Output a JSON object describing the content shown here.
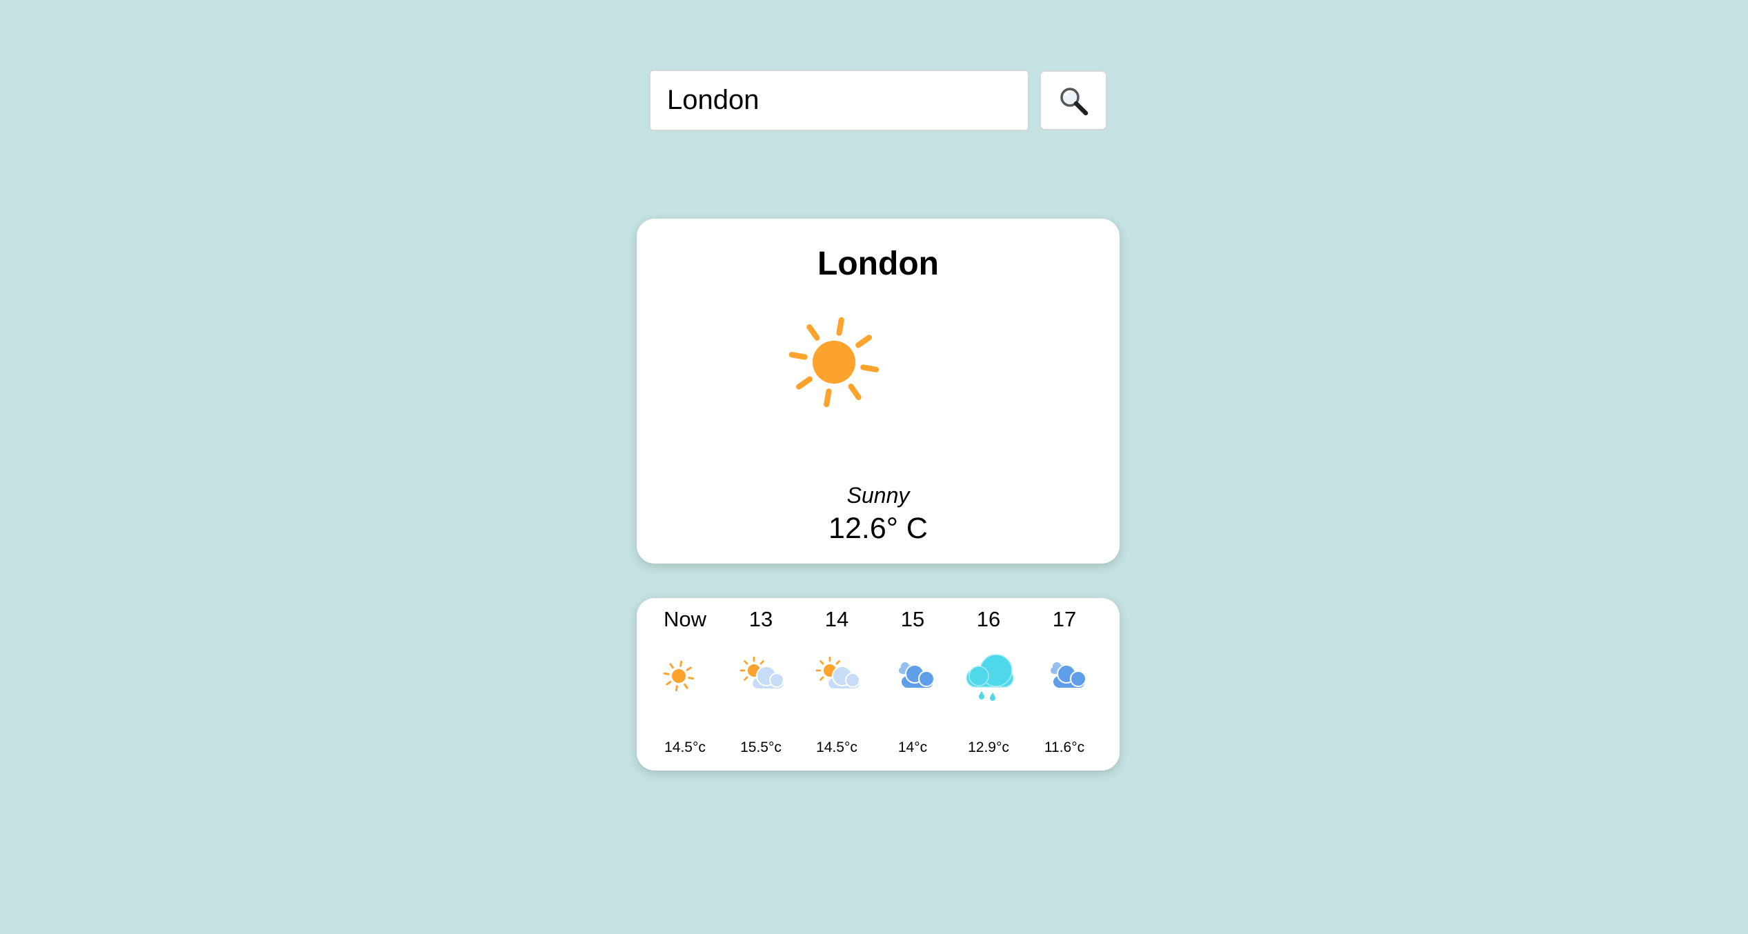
{
  "search": {
    "value": "London",
    "button_icon": "magnifying-glass-icon"
  },
  "current": {
    "city": "London",
    "icon": "sun-icon",
    "condition": "Sunny",
    "temperature": "12.6° C"
  },
  "forecast": [
    {
      "label": "Now",
      "icon": "sun-icon",
      "temp": "14.5°c"
    },
    {
      "label": "13",
      "icon": "partly-cloudy-icon",
      "temp": "15.5°c"
    },
    {
      "label": "14",
      "icon": "partly-cloudy-icon",
      "temp": "14.5°c"
    },
    {
      "label": "15",
      "icon": "cloudy-icon",
      "temp": "14°c"
    },
    {
      "label": "16",
      "icon": "rain-cloud-icon",
      "temp": "12.9°c"
    },
    {
      "label": "17",
      "icon": "cloudy-icon",
      "temp": "11.6°c"
    }
  ],
  "colors": {
    "background": "#c4e2e1",
    "sun": "#fba32c",
    "cloud_light": "#c7dcf7",
    "cloud_blue": "#5f9fe9",
    "rain_cloud": "#4fd8ea"
  }
}
